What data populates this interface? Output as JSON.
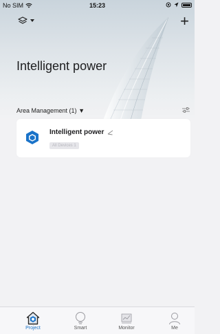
{
  "status_bar": {
    "carrier": "No SIM",
    "time": "15:23"
  },
  "header": {
    "title": "Intelligent power",
    "layers_icon": "layers-icon",
    "add_label": "+"
  },
  "area": {
    "label": "Area Management (1)",
    "caret": "▼"
  },
  "project_card": {
    "name": "Intelligent power",
    "badge": "All Devices 1",
    "icon": "cube-icon"
  },
  "tabs": [
    {
      "label": "Project",
      "icon": "home-icon",
      "active": true
    },
    {
      "label": "Smart",
      "icon": "bulb-icon",
      "active": false
    },
    {
      "label": "Monitor",
      "icon": "monitor-chart-icon",
      "active": false
    },
    {
      "label": "Me",
      "icon": "person-icon",
      "active": false
    }
  ],
  "colors": {
    "accent": "#1a73c9",
    "background": "#f2f2f4"
  }
}
